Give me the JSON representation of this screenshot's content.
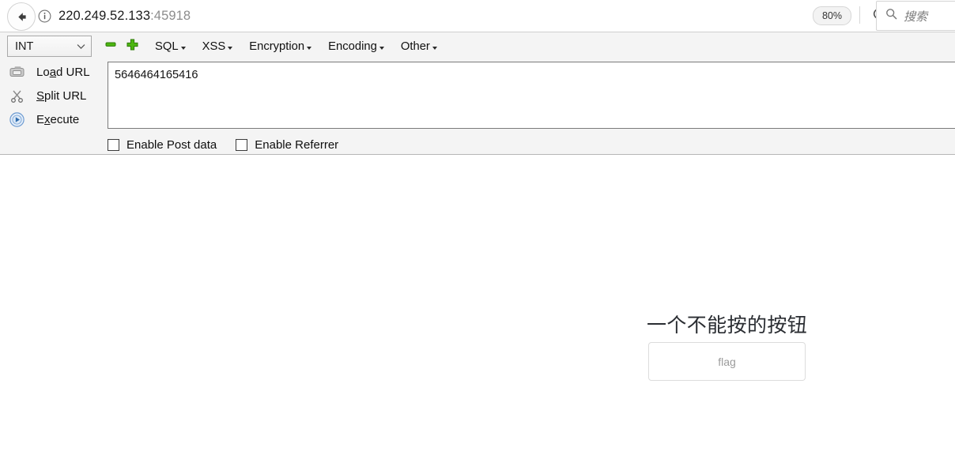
{
  "browser": {
    "back_icon": "back-arrow-icon",
    "info_icon": "info-circle-icon",
    "url_host": "220.249.52.133",
    "url_port": ":45918",
    "zoom_level": "80%",
    "reload_icon": "reload-icon",
    "search_icon": "search-icon",
    "search_placeholder": "搜索"
  },
  "hackbar": {
    "type_select": {
      "value": "INT",
      "chevron_icon": "chevron-down-icon"
    },
    "minus_icon": "minus-icon",
    "plus_icon": "plus-icon",
    "menus": [
      {
        "label": "SQL"
      },
      {
        "label": "XSS"
      },
      {
        "label": "Encryption"
      },
      {
        "label": "Encoding"
      },
      {
        "label": "Other"
      }
    ],
    "actions": [
      {
        "icon": "load-url-icon",
        "prefix": "Lo",
        "accel": "a",
        "suffix": "d URL"
      },
      {
        "icon": "split-url-icon",
        "prefix": "",
        "accel": "S",
        "suffix": "plit URL"
      },
      {
        "icon": "execute-icon",
        "prefix": "E",
        "accel": "x",
        "suffix": "ecute"
      }
    ],
    "url_textarea": {
      "value": "5646464165416",
      "placeholder": ""
    },
    "checkboxes": [
      {
        "label": "Enable Post data",
        "checked": false
      },
      {
        "label": "Enable Referrer",
        "checked": false
      }
    ]
  },
  "content": {
    "heading": "一个不能按的按钮",
    "flag_button_label": "flag"
  },
  "colors": {
    "accent_green": "#3fa40b",
    "execute_blue": "#4a86c8",
    "panel_bg": "#f4f4f4",
    "border_gray": "#b7b7b7"
  }
}
